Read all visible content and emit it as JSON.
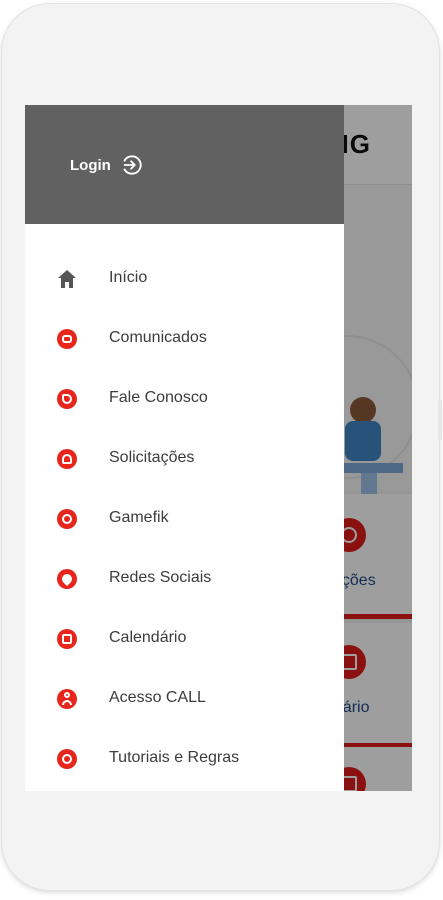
{
  "background_app": {
    "header_text": "NG",
    "cards": [
      {
        "label": "itações"
      },
      {
        "label": "ndário"
      }
    ]
  },
  "drawer": {
    "login_label": "Login",
    "login_icon": "login-arrow-icon",
    "items": [
      {
        "label": "Início",
        "icon": "home-icon"
      },
      {
        "label": "Comunicados",
        "icon": "chat-icon"
      },
      {
        "label": "Fale Conosco",
        "icon": "phone-icon"
      },
      {
        "label": "Solicitações",
        "icon": "request-icon"
      },
      {
        "label": "Gamefik",
        "icon": "game-icon"
      },
      {
        "label": "Redes Sociais",
        "icon": "heart-icon"
      },
      {
        "label": "Calendário",
        "icon": "calendar-icon"
      },
      {
        "label": "Acesso CALL",
        "icon": "user-icon"
      },
      {
        "label": "Tutoriais e Regras",
        "icon": "globe-icon"
      }
    ]
  },
  "colors": {
    "accent": "#e8251b",
    "drawer_header": "#616161",
    "card_label": "#1f4a8a"
  }
}
